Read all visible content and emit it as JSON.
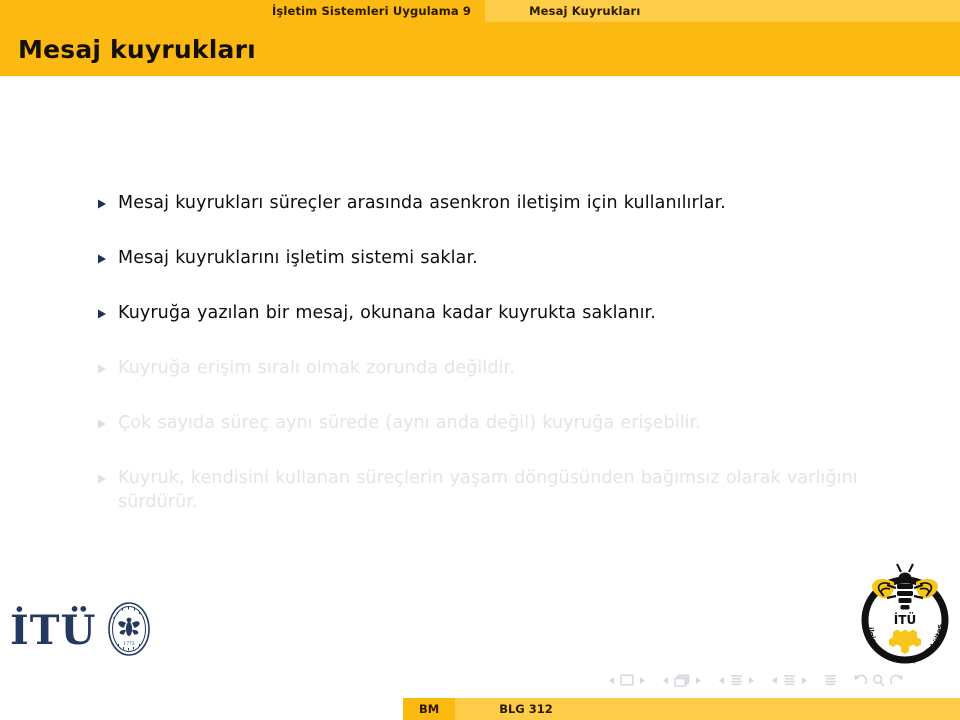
{
  "headline": {
    "section_label": "İşletim Sistemleri Uygulama 9",
    "subsection_label": "Mesaj Kuyrukları"
  },
  "slide": {
    "title": "Mesaj kuyrukları",
    "items": [
      {
        "text": "Mesaj kuyrukları süreçler arasında asenkron iletişim için kullanılırlar.",
        "faded": false
      },
      {
        "text": "Mesaj kuyruklarını işletim sistemi saklar.",
        "faded": false
      },
      {
        "text": "Kuyruğa yazılan bir mesaj, okunana kadar kuyrukta saklanır.",
        "faded": false
      },
      {
        "text": "Kuyruğa erişim sıralı olmak zorunda değildir.",
        "faded": true
      },
      {
        "text": "Çok sayıda süreç aynı sürede (aynı anda değil) kuyruğa erişebilir.",
        "faded": true
      },
      {
        "text": "Kuyruk, kendisini kullanan süreçlerin yaşam döngüsünden bağımsız olarak varlığını sürdürür.",
        "faded": true
      }
    ]
  },
  "logos": {
    "itu_wordmark": "İTÜ",
    "itu_seal_name": "itu-university-seal",
    "faculty_logo_name": "itu-computer-informatics-faculty-bee-logo",
    "faculty_logo_inner_text": "İTÜ",
    "faculty_logo_ring_text": "Bilgisayar ve Bilişim Fakültesi"
  },
  "navigation": {
    "icons": [
      "prev-slide-icon",
      "slide-icon",
      "next-slide-icon",
      "prev-frame-icon",
      "frame-icon",
      "next-frame-icon",
      "prev-subsection-icon",
      "subsection-icon",
      "next-subsection-icon",
      "prev-section-icon",
      "section-icon",
      "next-section-icon",
      "document-icon",
      "back-icon",
      "search-icon",
      "forward-icon"
    ]
  },
  "footline": {
    "author": "BM",
    "course": "BLG 312"
  },
  "colors": {
    "accent_dark": "#fbb911",
    "accent_light": "#fdcd49",
    "text": "#0d0d11",
    "faded_text": "#e3e3e8",
    "bullet": "#20305c",
    "itu_navy": "#25395e",
    "bee_yellow": "#f6c619"
  }
}
